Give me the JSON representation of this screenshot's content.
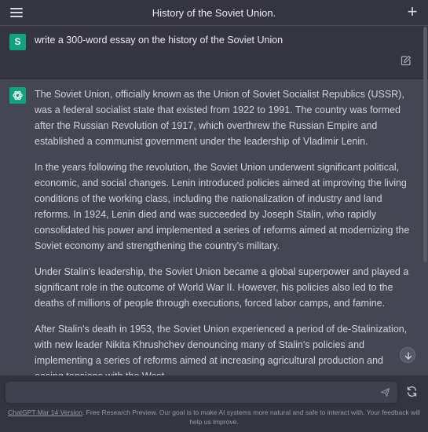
{
  "header": {
    "title": "History of the Soviet Union.",
    "menu_icon": "hamburger-menu-icon",
    "new_chat_icon": "plus-icon"
  },
  "user_message": {
    "avatar_letter": "S",
    "text": "write a 300-word essay on the history of the Soviet Union"
  },
  "assistant_message": {
    "paragraphs": [
      "The Soviet Union, officially known as the Union of Soviet Socialist Republics (USSR), was a federal socialist state that existed from 1922 to 1991. The country was formed after the Russian Revolution of 1917, which overthrew the Russian Empire and established a communist government under the leadership of Vladimir Lenin.",
      "In the years following the revolution, the Soviet Union underwent significant political, economic, and social changes. Lenin introduced policies aimed at improving the living conditions of the working class, including the nationalization of industry and land reforms. In 1924, Lenin died and was succeeded by Joseph Stalin, who rapidly consolidated his power and implemented a series of reforms aimed at modernizing the Soviet economy and strengthening the country's military.",
      "Under Stalin's leadership, the Soviet Union became a global superpower and played a significant role in the outcome of World War II. However, his policies also led to the deaths of millions of people through executions, forced labor camps, and famine.",
      "After Stalin's death in 1953, the Soviet Union experienced a period of de-Stalinization, with new leader Nikita Khrushchev denouncing many of Stalin's policies and implementing a series of reforms aimed at increasing agricultural production and easing tensions with the West."
    ]
  },
  "composer": {
    "value": "",
    "placeholder": ""
  },
  "footer": {
    "link_text": "ChatGPT Mar 14 Version",
    "text": ". Free Research Preview. Our goal is to make AI systems more natural and safe to interact with. Your feedback will help us improve."
  },
  "colors": {
    "background": "#343541",
    "assistant_background": "#444654",
    "accent": "#10a37f"
  }
}
